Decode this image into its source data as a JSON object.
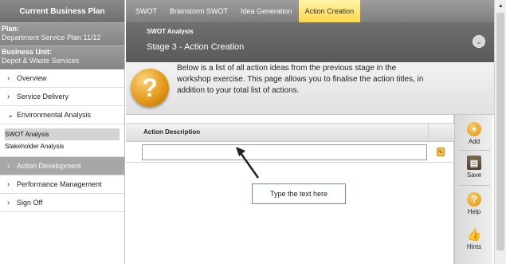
{
  "sidebar": {
    "title": "Current Business Plan",
    "plan_label": "Plan:",
    "plan_value": "Department Service Plan 11/12",
    "unit_label": "Business Unit:",
    "unit_value": "Depot & Waste Services",
    "items": [
      {
        "label": "Overview",
        "chevron": "›"
      },
      {
        "label": "Service Delivery",
        "chevron": "›"
      },
      {
        "label": "Environmental Analysis",
        "chevron": "⌄"
      },
      {
        "label": "Action Development",
        "chevron": "›"
      },
      {
        "label": "Performance Management",
        "chevron": "›"
      },
      {
        "label": "Sign Off",
        "chevron": "›"
      }
    ],
    "subitems": [
      {
        "label": "SWOT Analysis"
      },
      {
        "label": "Stakeholder Analysis"
      }
    ]
  },
  "tabs": [
    {
      "label": "SWOT"
    },
    {
      "label": "Brainstorm SWOT"
    },
    {
      "label": "Idea Generation"
    },
    {
      "label": "Action Creation"
    }
  ],
  "stage": {
    "small_title": "SWOT Analysis",
    "title": "Stage 3 - Action Creation",
    "collapse_glyph": "⌄"
  },
  "help": {
    "icon_glyph": "?",
    "text": "Below is a list of all action ideas from the previous stage in the workshop exercise. This page allows you to finalise the action titles, in addition to your total list of actions."
  },
  "grid": {
    "column_header": "Action Description",
    "input_value": "",
    "row_icon_glyph": "✎"
  },
  "callout": {
    "text": "Type the text here"
  },
  "toolbar": {
    "add_label": "Add",
    "save_label": "Save",
    "help_label": "Help",
    "hints_label": "Hints",
    "add_glyph": "+",
    "save_glyph": "▤",
    "help_glyph": "?",
    "hints_glyph": "👍"
  },
  "colors": {
    "active_tab": "#ffd84a",
    "header_gray": "#6f6f6f",
    "icon_orange": "#e59a1a",
    "callout_border": "#6f86c8"
  },
  "icons": {
    "help_badge": "question-icon",
    "add": "plus-circle-icon",
    "save": "floppy-disk-icon",
    "help": "question-icon",
    "hints": "thumbs-up-icon",
    "collapse": "chevron-down-icon",
    "row": "edit-icon"
  }
}
